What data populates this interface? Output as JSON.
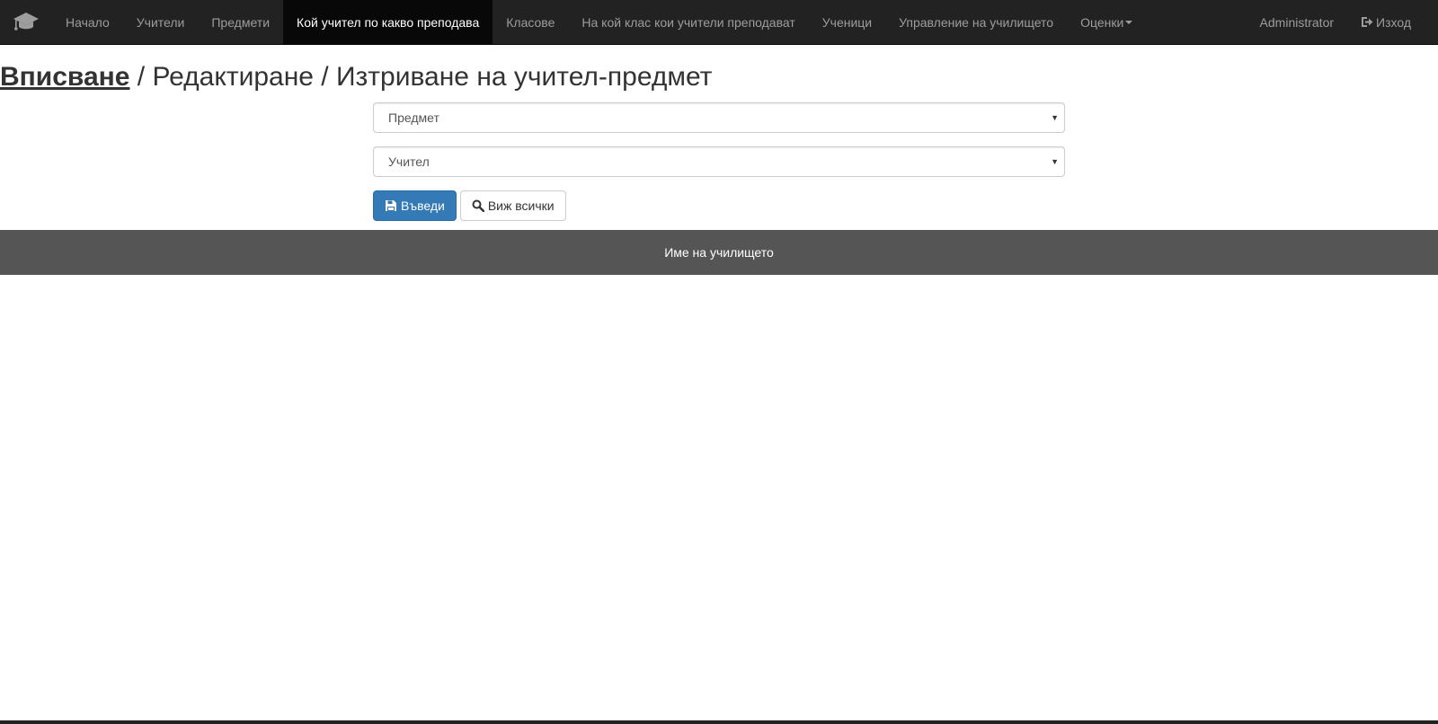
{
  "navbar": {
    "brand_icon": "graduation-cap-icon",
    "items": [
      {
        "label": "Начало"
      },
      {
        "label": "Учители"
      },
      {
        "label": "Предмети"
      },
      {
        "label": "Кой учител по какво преподава",
        "active": true
      },
      {
        "label": "Класове"
      },
      {
        "label": "На кой клас кои учители преподават"
      },
      {
        "label": "Ученици"
      },
      {
        "label": "Управление на училището"
      },
      {
        "label": "Оценки"
      }
    ],
    "user_label": "Administrator",
    "logout_label": "Изход",
    "logout_icon": "log-out-icon"
  },
  "page": {
    "title_link": "Вписване",
    "title_rest": " / Редактиране / Изтриване на учител-предмет"
  },
  "form": {
    "subject_select": "Предмет",
    "teacher_select": "Учител",
    "submit_label": "Въведи",
    "submit_icon": "save-icon",
    "view_all_label": "Виж всички",
    "view_all_icon": "search-icon"
  },
  "footer": {
    "text": "Име на училището"
  },
  "colors": {
    "navbar_bg": "#222222",
    "nav_active_bg": "#080808",
    "primary": "#337ab7",
    "footer_bg": "#555555"
  }
}
